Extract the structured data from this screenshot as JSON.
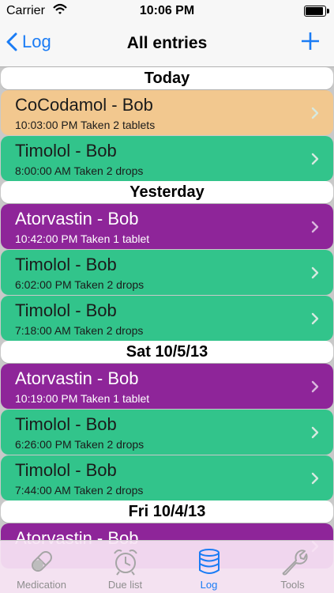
{
  "status_bar": {
    "carrier": "Carrier",
    "time": "10:06 PM"
  },
  "nav": {
    "back_label": "Log",
    "title": "All entries"
  },
  "sections": [
    {
      "header": "Today",
      "entries": [
        {
          "name": "CoCodamol - Bob",
          "detail": "10:03:00 PM Taken 2 tablets",
          "color": "orange"
        },
        {
          "name": "Timolol - Bob",
          "detail": "8:00:00 AM Taken 2 drops",
          "color": "green"
        }
      ]
    },
    {
      "header": "Yesterday",
      "entries": [
        {
          "name": "Atorvastin - Bob",
          "detail": "10:42:00 PM Taken 1 tablet",
          "color": "purple"
        },
        {
          "name": "Timolol - Bob",
          "detail": "6:02:00 PM Taken 2 drops",
          "color": "green"
        },
        {
          "name": "Timolol - Bob",
          "detail": "7:18:00 AM Taken 2 drops",
          "color": "green"
        }
      ]
    },
    {
      "header": "Sat 10/5/13",
      "entries": [
        {
          "name": "Atorvastin - Bob",
          "detail": "10:19:00 PM Taken 1 tablet",
          "color": "purple"
        },
        {
          "name": "Timolol - Bob",
          "detail": "6:26:00 PM Taken 2 drops",
          "color": "green"
        },
        {
          "name": "Timolol - Bob",
          "detail": "7:44:00 AM Taken 2 drops",
          "color": "green"
        }
      ]
    },
    {
      "header": "Fri 10/4/13",
      "entries": [
        {
          "name": "Atorvastin - Bob",
          "detail": "",
          "color": "purple"
        }
      ]
    }
  ],
  "colors": {
    "orange": "#f2c88f",
    "green": "#32c48b",
    "purple": "#8e2599",
    "accent": "#1a7cf5"
  },
  "tabs": [
    {
      "label": "Medication",
      "icon": "pill-icon",
      "active": false
    },
    {
      "label": "Due list",
      "icon": "alarm-clock-icon",
      "active": false
    },
    {
      "label": "Log",
      "icon": "database-icon",
      "active": true
    },
    {
      "label": "Tools",
      "icon": "wrench-icon",
      "active": false
    }
  ]
}
